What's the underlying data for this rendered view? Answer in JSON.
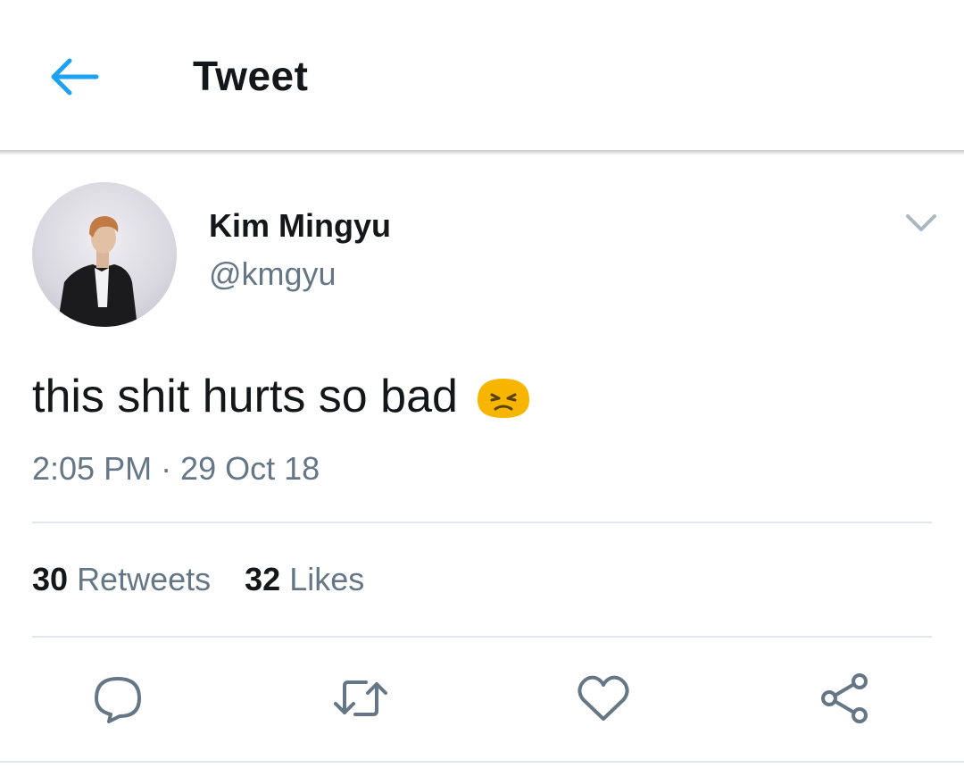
{
  "header": {
    "title": "Tweet",
    "back_icon": "arrow-left-icon"
  },
  "tweet": {
    "author_name": "Kim Mingyu",
    "author_handle": "@kmgyu",
    "text": "this shit hurts so bad",
    "emoji": "persevering-face-emoji",
    "timestamp": "2:05 PM · 29 Oct 18"
  },
  "stats": {
    "retweets_count": "30",
    "retweets_label": "Retweets",
    "likes_count": "32",
    "likes_label": "Likes"
  },
  "actions": [
    "reply-icon",
    "retweet-icon",
    "like-icon",
    "share-icon"
  ],
  "colors": {
    "accent": "#1da1f2",
    "text_primary": "#14171a",
    "text_secondary": "#657786",
    "icon_gray": "#657786",
    "divider": "#e1e8ed"
  }
}
